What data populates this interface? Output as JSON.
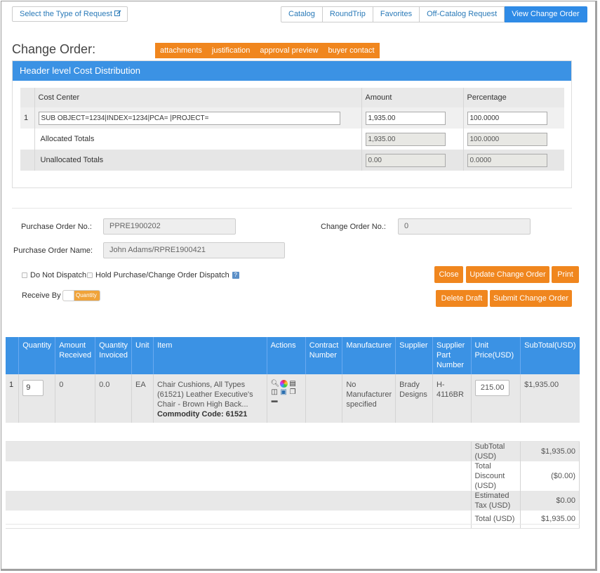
{
  "top": {
    "select_request": "Select the Type of Request",
    "nav": [
      "Catalog",
      "RoundTrip",
      "Favorites",
      "Off-Catalog Request",
      "View Change Order"
    ]
  },
  "page": {
    "title": "Change Order:",
    "tags": [
      "attachments",
      "justification",
      "approval preview",
      "buyer contact"
    ]
  },
  "cost": {
    "panel_title": "Header level Cost Distribution",
    "headers": {
      "cost_center": "Cost Center",
      "amount": "Amount",
      "percentage": "Percentage"
    },
    "row_num": "1",
    "cost_center_value": "SUB OBJECT=1234|INDEX=1234|PCA= |PROJECT=",
    "amount_value": "1,935.00",
    "percentage_value": "100.0000",
    "allocated_label": "Allocated Totals",
    "allocated_amount": "1,935.00",
    "allocated_percentage": "100.0000",
    "unallocated_label": "Unallocated Totals",
    "unallocated_amount": "0.00",
    "unallocated_percentage": "0.0000"
  },
  "po": {
    "po_no_label": "Purchase Order No.:",
    "po_no_value": "PPRE1900202",
    "co_no_label": "Change Order No.:",
    "co_no_value": "0",
    "po_name_label": "Purchase Order Name:",
    "po_name_value": "John Adams/RPRE1900421",
    "do_not_dispatch": "Do Not Dispatch",
    "hold_dispatch": "Hold Purchase/Change Order Dispatch",
    "receive_by_label": "Receive By",
    "receive_by_value": "Quantity"
  },
  "buttons": {
    "close": "Close",
    "update": "Update Change Order",
    "print": "Print",
    "delete_draft": "Delete Draft",
    "submit": "Submit Change Order"
  },
  "items": {
    "headers": [
      "Quantity",
      "Amount Received",
      "Quantity Invoiced",
      "Unit",
      "Item",
      "Actions",
      "Contract Number",
      "Manufacturer",
      "Supplier",
      "Supplier Part Number",
      "Unit Price(USD)",
      "SubTotal(USD)"
    ],
    "rows": [
      {
        "num": "1",
        "quantity": "9",
        "amount_received": "0",
        "quantity_invoiced": "0.0",
        "unit": "EA",
        "item_desc": "Chair Cushions, All Types (61521) Leather Executive's Chair - Brown High Back...",
        "commodity": "Commodity Code: 61521",
        "contract_number": "",
        "manufacturer": "No Manufacturer specified",
        "supplier": "Brady Designs",
        "supplier_part": "H-4116BR",
        "unit_price": "215.00",
        "subtotal": "$1,935.00"
      }
    ],
    "totals": [
      {
        "label": "SubTotal (USD)",
        "value": "$1,935.00"
      },
      {
        "label": "Total Discount (USD)",
        "value": "($0.00)"
      },
      {
        "label": "Estimated Tax (USD)",
        "value": "$0.00"
      },
      {
        "label": "Total (USD)",
        "value": "$1,935.00"
      }
    ]
  }
}
